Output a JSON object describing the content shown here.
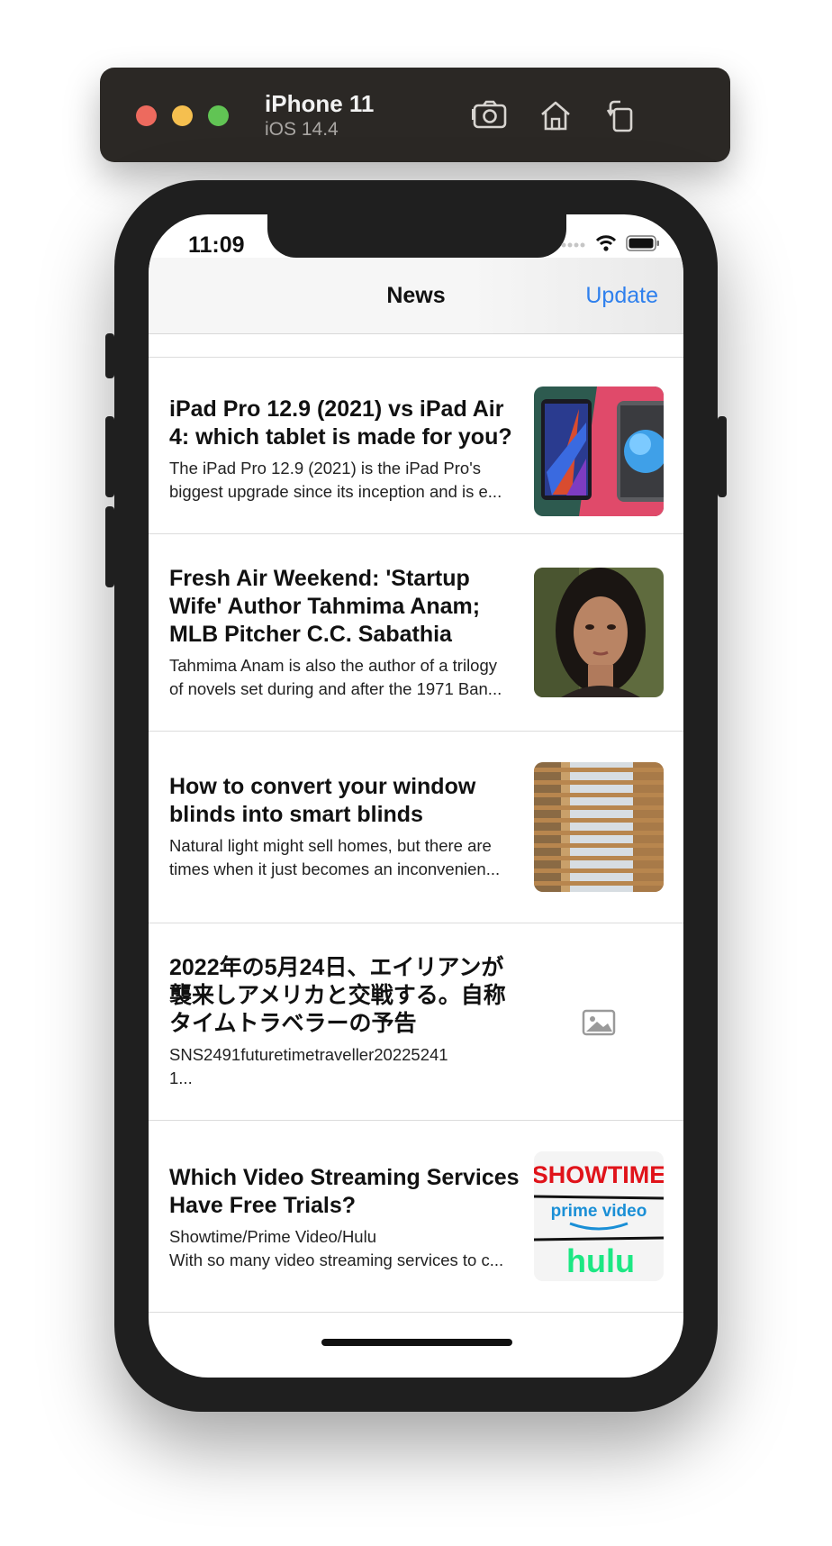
{
  "simulator": {
    "device_name": "iPhone 11",
    "os_version": "iOS 14.4",
    "icons": [
      "screenshot-icon",
      "home-icon",
      "rotate-icon"
    ]
  },
  "status_bar": {
    "time": "11:09"
  },
  "navbar": {
    "title": "News",
    "update_label": "Update"
  },
  "articles": [
    {
      "title": "iPad Pro 12.9 (2021) vs iPad Air 4: which tablet is made for you?",
      "description": "The iPad Pro 12.9 (2021) is the iPad Pro's\nbiggest upgrade since its inception and is e...",
      "thumbnail": "ipad-image"
    },
    {
      "title": "Fresh Air Weekend: 'Startup Wife' Author Tahmima Anam; MLB Pitcher C.C. Sabathia",
      "description": "Tahmima Anam is also the author of a trilogy\nof novels set during and after the 1971 Ban...",
      "thumbnail": "portrait-image"
    },
    {
      "title": "How to convert your window blinds into smart blinds",
      "description": "Natural light might sell homes, but there are\ntimes when it just becomes an inconvenien...",
      "thumbnail": "blinds-image"
    },
    {
      "title": "2022年の5月24日、エイリアンが襲来しアメリカと交戦する。自称タイムトラベラーの予告",
      "description": "SNS2491futuretimetraveller20225241\n1...",
      "thumbnail": "placeholder-image-icon"
    },
    {
      "title": "Which Video Streaming Services Have Free Trials?",
      "description": "Showtime/Prime Video/Hulu\nWith so many video streaming services to c...",
      "thumbnail": "streaming-logos-image",
      "logo_text": [
        "SHOWTIME",
        "prime video",
        "hulu"
      ]
    }
  ],
  "colors": {
    "accent": "#2f80ed",
    "device": "#1f1f1f",
    "simulator_bar": "#2b2825"
  }
}
